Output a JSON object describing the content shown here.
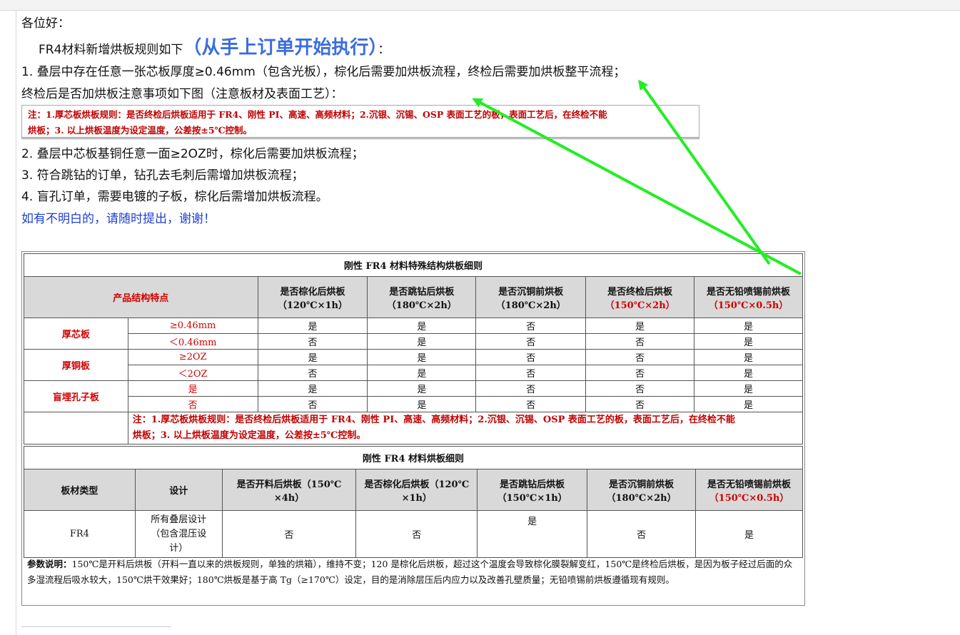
{
  "intro": {
    "greeting": "各位好：",
    "rule_prefix": "FR4材料新增烘板规则如下",
    "rule_emphasis": "（从手上订单开始执行）",
    "rule_suffix": "：",
    "item1": "1. 叠层中存在任意一张芯板厚度≥0.46mm（包含光板），棕化后需要加烘板流程，终检后需要加烘板整平流程；",
    "item1_note": "终检后是否加烘板注意事项如下图（注意板材及表面工艺）：",
    "note_box_line1": "注：1.厚芯板烘板规则：是否终检后烘板适用于 FR4、刚性 PI、高速、高频材料；2.沉银、沉锡、OSP 表面工艺的板，表面工艺后，在终检不能",
    "note_box_line2": "烘板；3. 以上烘板温度为设定温度，公差按±5℃控制。",
    "item2": "2. 叠层中芯板基铜任意一面≥2OZ时，棕化后需要加烘板流程；",
    "item3": "3. 符合跳钻的订单，钻孔去毛刺后需增加烘板流程；",
    "item4": "4. 盲孔订单，需要电镀的子板，棕化后需增加烘板流程。",
    "closing": "如有不明白的，请随时提出，谢谢！"
  },
  "table1": {
    "title": "刚性 FR4 材料特殊结构烘板细则",
    "feature_header": "产品结构特点",
    "headers": [
      {
        "line1": "是否棕化后烘板",
        "line2": "（120℃×1h）",
        "red": false
      },
      {
        "line1": "是否跳钻后烘板",
        "line2": "（180℃×2h）",
        "red": false
      },
      {
        "line1": "是否沉铜前烘板",
        "line2": "（180℃×2h）",
        "red": false
      },
      {
        "line1": "是否终检后烘板",
        "line2": "（150℃×2h）",
        "red": true
      },
      {
        "line1": "是否无铅喷锡前烘板",
        "line2": "（150℃×0.5h）",
        "red": true
      }
    ],
    "groups": [
      {
        "name": "厚芯板",
        "rows": [
          {
            "cond": "≥0.46mm",
            "vals": [
              "是",
              "是",
              "否",
              "是",
              "是"
            ]
          },
          {
            "cond": "＜0.46mm",
            "vals": [
              "否",
              "是",
              "否",
              "否",
              "是"
            ]
          }
        ]
      },
      {
        "name": "厚铜板",
        "rows": [
          {
            "cond": "≥2OZ",
            "vals": [
              "是",
              "是",
              "否",
              "否",
              "是"
            ]
          },
          {
            "cond": "＜2OZ",
            "vals": [
              "否",
              "是",
              "否",
              "否",
              "是"
            ]
          }
        ]
      },
      {
        "name": "盲埋孔子板",
        "rows": [
          {
            "cond": "是",
            "vals": [
              "是",
              "是",
              "否",
              "否",
              "是"
            ]
          },
          {
            "cond": "否",
            "vals": [
              "否",
              "是",
              "否",
              "否",
              "是"
            ]
          }
        ]
      }
    ],
    "note_line1": "注：1.厚芯板烘板规则：是否终检后烘板适用于 FR4、刚性 PI、高速、高频材料；2.沉银、沉锡、OSP 表面工艺的板，表面工艺后，在终检不能",
    "note_line2": "烘板；3. 以上烘板温度为设定温度，公差按±5℃控制。"
  },
  "table2": {
    "title": "刚性 FR4 材料烘板细则",
    "col_material": "板材类型",
    "col_design": "设计",
    "headers": [
      {
        "line1": "是否开料后烘板（150℃",
        "line2": "×4h）",
        "red": false
      },
      {
        "line1": "是否棕化后烘板（120℃",
        "line2": "×1h）",
        "red": false
      },
      {
        "line1": "是否跳钻后烘板",
        "line2": "（150℃×1h）",
        "red": false
      },
      {
        "line1": "是否沉铜前烘板",
        "line2": "（180℃×2h）",
        "red": false
      },
      {
        "line1": "是否无铅喷锡前烘板",
        "line2": "（150℃×0.5h）",
        "red": true
      }
    ],
    "row": {
      "material": "FR4",
      "design_line1": "所有叠层设计",
      "design_line2": "（包含混压设",
      "design_line3": "计）",
      "vals": [
        "否",
        "否",
        "是",
        "否",
        "是"
      ]
    },
    "explain_label": "参数说明：",
    "explain_text": "150℃是开料后烘板（开料一直以来的烘板规则，单独的烘箱），维持不变；120 是棕化后烘板，超过这个温度会导致棕化膜裂解变红，150℃是终检后烘板，是因为板子经过后面的众多湿流程后吸水较大，150℃烘干效果好；180℃烘板是基于高 Tg（≥170℃）设定，目的是消除层压后内应力以及改善孔壁质量；无铅喷锡前烘板遵循现有规则。"
  },
  "colors": {
    "arrow": "#22ee22",
    "note_red": "#c00000",
    "link_blue": "#1f3fd0",
    "emphasis_blue": "#3b6de0"
  }
}
